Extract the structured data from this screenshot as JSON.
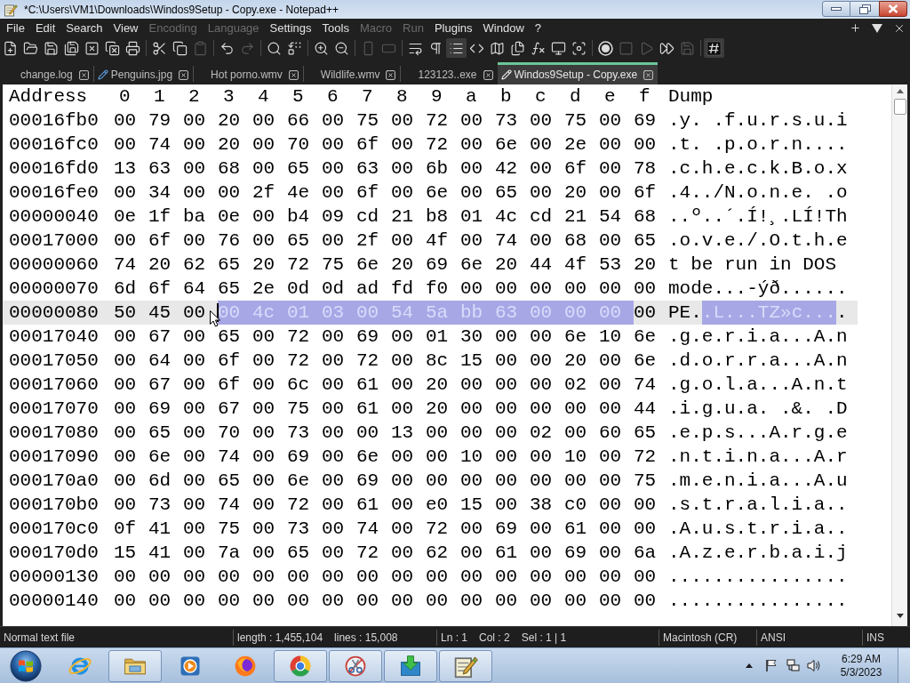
{
  "window": {
    "title": "*C:\\Users\\VM1\\Downloads\\Windos9Setup - Copy.exe - Notepad++"
  },
  "menu": [
    {
      "label": "File",
      "disabled": false
    },
    {
      "label": "Edit",
      "disabled": false
    },
    {
      "label": "Search",
      "disabled": false
    },
    {
      "label": "View",
      "disabled": false
    },
    {
      "label": "Encoding",
      "disabled": true
    },
    {
      "label": "Language",
      "disabled": true
    },
    {
      "label": "Settings",
      "disabled": false
    },
    {
      "label": "Tools",
      "disabled": false
    },
    {
      "label": "Macro",
      "disabled": true
    },
    {
      "label": "Run",
      "disabled": true
    },
    {
      "label": "Plugins",
      "disabled": false
    },
    {
      "label": "Window",
      "disabled": false
    },
    {
      "label": "?",
      "disabled": false
    }
  ],
  "toolbar": {
    "groups": [
      [
        {
          "disabled": false,
          "pressed": false
        },
        {
          "disabled": false,
          "pressed": false
        },
        {
          "disabled": false,
          "pressed": false
        },
        {
          "disabled": false,
          "pressed": false
        },
        {
          "disabled": false,
          "pressed": false
        },
        {
          "disabled": false,
          "pressed": false
        },
        {
          "disabled": false,
          "pressed": false
        }
      ],
      [
        {
          "disabled": false,
          "pressed": false
        },
        {
          "disabled": false,
          "pressed": false
        },
        {
          "disabled": true,
          "pressed": false
        }
      ],
      [
        {
          "disabled": false,
          "pressed": false
        },
        {
          "disabled": true,
          "pressed": false
        }
      ],
      [
        {
          "disabled": false,
          "pressed": false
        },
        {
          "disabled": false,
          "pressed": false
        }
      ],
      [
        {
          "disabled": false,
          "pressed": false
        },
        {
          "disabled": false,
          "pressed": false
        }
      ],
      [
        {
          "disabled": true,
          "pressed": false
        },
        {
          "disabled": true,
          "pressed": false
        }
      ],
      [
        {
          "disabled": false,
          "pressed": false
        },
        {
          "disabled": false,
          "pressed": false
        },
        {
          "disabled": false,
          "pressed": true
        },
        {
          "disabled": false,
          "pressed": false
        },
        {
          "disabled": false,
          "pressed": false
        },
        {
          "disabled": false,
          "pressed": false
        },
        {
          "disabled": false,
          "pressed": false
        },
        {
          "disabled": false,
          "pressed": false
        },
        {
          "disabled": false,
          "pressed": false
        }
      ],
      [
        {
          "disabled": false,
          "pressed": false
        },
        {
          "disabled": true,
          "pressed": false
        },
        {
          "disabled": true,
          "pressed": false
        },
        {
          "disabled": false,
          "pressed": false
        },
        {
          "disabled": true,
          "pressed": false
        }
      ],
      [
        {
          "disabled": false,
          "pressed": true
        }
      ]
    ]
  },
  "tabs": [
    {
      "label": "change.log",
      "modified": false,
      "selected": false
    },
    {
      "label": "Penguins.jpg",
      "modified": true,
      "selected": false
    },
    {
      "label": "Hot porno.wmv",
      "modified": false,
      "selected": false
    },
    {
      "label": "Wildlife.wmv",
      "modified": false,
      "selected": false
    },
    {
      "label": "123123..exe",
      "modified": false,
      "selected": false
    },
    {
      "label": "Windos9Setup - Copy.exe",
      "modified": true,
      "selected": true
    }
  ],
  "hex_view": {
    "columns": [
      "Address",
      "0",
      "1",
      "2",
      "3",
      "4",
      "5",
      "6",
      "7",
      "8",
      "9",
      "a",
      "b",
      "c",
      "d",
      "e",
      "f",
      "Dump"
    ],
    "rows": [
      {
        "address": "00016fb0",
        "current_line": false,
        "bytes": [
          {
            "hex": "00",
            "selected": false
          },
          {
            "hex": "79",
            "selected": false
          },
          {
            "hex": "00",
            "selected": false
          },
          {
            "hex": "20",
            "selected": false
          },
          {
            "hex": "00",
            "selected": false
          },
          {
            "hex": "66",
            "selected": false
          },
          {
            "hex": "00",
            "selected": false
          },
          {
            "hex": "75",
            "selected": false
          },
          {
            "hex": "00",
            "selected": false
          },
          {
            "hex": "72",
            "selected": false
          },
          {
            "hex": "00",
            "selected": false
          },
          {
            "hex": "73",
            "selected": false
          },
          {
            "hex": "00",
            "selected": false
          },
          {
            "hex": "75",
            "selected": false
          },
          {
            "hex": "00",
            "selected": false
          },
          {
            "hex": "69",
            "selected": false
          }
        ],
        "dump": [
          {
            "text": ".y. .f.u.r.s.u.i",
            "selected": false
          }
        ]
      },
      {
        "address": "00016fc0",
        "current_line": false,
        "bytes": [
          {
            "hex": "00",
            "selected": false
          },
          {
            "hex": "74",
            "selected": false
          },
          {
            "hex": "00",
            "selected": false
          },
          {
            "hex": "20",
            "selected": false
          },
          {
            "hex": "00",
            "selected": false
          },
          {
            "hex": "70",
            "selected": false
          },
          {
            "hex": "00",
            "selected": false
          },
          {
            "hex": "6f",
            "selected": false
          },
          {
            "hex": "00",
            "selected": false
          },
          {
            "hex": "72",
            "selected": false
          },
          {
            "hex": "00",
            "selected": false
          },
          {
            "hex": "6e",
            "selected": false
          },
          {
            "hex": "00",
            "selected": false
          },
          {
            "hex": "2e",
            "selected": false
          },
          {
            "hex": "00",
            "selected": false
          },
          {
            "hex": "00",
            "selected": false
          }
        ],
        "dump": [
          {
            "text": ".t. .p.o.r.n....",
            "selected": false
          }
        ]
      },
      {
        "address": "00016fd0",
        "current_line": false,
        "bytes": [
          {
            "hex": "13",
            "selected": false
          },
          {
            "hex": "63",
            "selected": false
          },
          {
            "hex": "00",
            "selected": false
          },
          {
            "hex": "68",
            "selected": false
          },
          {
            "hex": "00",
            "selected": false
          },
          {
            "hex": "65",
            "selected": false
          },
          {
            "hex": "00",
            "selected": false
          },
          {
            "hex": "63",
            "selected": false
          },
          {
            "hex": "00",
            "selected": false
          },
          {
            "hex": "6b",
            "selected": false
          },
          {
            "hex": "00",
            "selected": false
          },
          {
            "hex": "42",
            "selected": false
          },
          {
            "hex": "00",
            "selected": false
          },
          {
            "hex": "6f",
            "selected": false
          },
          {
            "hex": "00",
            "selected": false
          },
          {
            "hex": "78",
            "selected": false
          }
        ],
        "dump": [
          {
            "text": ".c.h.e.c.k.B.o.x",
            "selected": false
          }
        ]
      },
      {
        "address": "00016fe0",
        "current_line": false,
        "bytes": [
          {
            "hex": "00",
            "selected": false
          },
          {
            "hex": "34",
            "selected": false
          },
          {
            "hex": "00",
            "selected": false
          },
          {
            "hex": "00",
            "selected": false
          },
          {
            "hex": "2f",
            "selected": false
          },
          {
            "hex": "4e",
            "selected": false
          },
          {
            "hex": "00",
            "selected": false
          },
          {
            "hex": "6f",
            "selected": false
          },
          {
            "hex": "00",
            "selected": false
          },
          {
            "hex": "6e",
            "selected": false
          },
          {
            "hex": "00",
            "selected": false
          },
          {
            "hex": "65",
            "selected": false
          },
          {
            "hex": "00",
            "selected": false
          },
          {
            "hex": "20",
            "selected": false
          },
          {
            "hex": "00",
            "selected": false
          },
          {
            "hex": "6f",
            "selected": false
          }
        ],
        "dump": [
          {
            "text": ".4../N.o.n.e. .o",
            "selected": false
          }
        ]
      },
      {
        "address": "00000040",
        "current_line": false,
        "bytes": [
          {
            "hex": "0e",
            "selected": false
          },
          {
            "hex": "1f",
            "selected": false
          },
          {
            "hex": "ba",
            "selected": false
          },
          {
            "hex": "0e",
            "selected": false
          },
          {
            "hex": "00",
            "selected": false
          },
          {
            "hex": "b4",
            "selected": false
          },
          {
            "hex": "09",
            "selected": false
          },
          {
            "hex": "cd",
            "selected": false
          },
          {
            "hex": "21",
            "selected": false
          },
          {
            "hex": "b8",
            "selected": false
          },
          {
            "hex": "01",
            "selected": false
          },
          {
            "hex": "4c",
            "selected": false
          },
          {
            "hex": "cd",
            "selected": false
          },
          {
            "hex": "21",
            "selected": false
          },
          {
            "hex": "54",
            "selected": false
          },
          {
            "hex": "68",
            "selected": false
          }
        ],
        "dump": [
          {
            "text": "..º..´.Í!¸.LÍ!Th",
            "selected": false
          }
        ]
      },
      {
        "address": "00017000",
        "current_line": false,
        "bytes": [
          {
            "hex": "00",
            "selected": false
          },
          {
            "hex": "6f",
            "selected": false
          },
          {
            "hex": "00",
            "selected": false
          },
          {
            "hex": "76",
            "selected": false
          },
          {
            "hex": "00",
            "selected": false
          },
          {
            "hex": "65",
            "selected": false
          },
          {
            "hex": "00",
            "selected": false
          },
          {
            "hex": "2f",
            "selected": false
          },
          {
            "hex": "00",
            "selected": false
          },
          {
            "hex": "4f",
            "selected": false
          },
          {
            "hex": "00",
            "selected": false
          },
          {
            "hex": "74",
            "selected": false
          },
          {
            "hex": "00",
            "selected": false
          },
          {
            "hex": "68",
            "selected": false
          },
          {
            "hex": "00",
            "selected": false
          },
          {
            "hex": "65",
            "selected": false
          }
        ],
        "dump": [
          {
            "text": ".o.v.e./.O.t.h.e",
            "selected": false
          }
        ]
      },
      {
        "address": "00000060",
        "current_line": false,
        "bytes": [
          {
            "hex": "74",
            "selected": false
          },
          {
            "hex": "20",
            "selected": false
          },
          {
            "hex": "62",
            "selected": false
          },
          {
            "hex": "65",
            "selected": false
          },
          {
            "hex": "20",
            "selected": false
          },
          {
            "hex": "72",
            "selected": false
          },
          {
            "hex": "75",
            "selected": false
          },
          {
            "hex": "6e",
            "selected": false
          },
          {
            "hex": "20",
            "selected": false
          },
          {
            "hex": "69",
            "selected": false
          },
          {
            "hex": "6e",
            "selected": false
          },
          {
            "hex": "20",
            "selected": false
          },
          {
            "hex": "44",
            "selected": false
          },
          {
            "hex": "4f",
            "selected": false
          },
          {
            "hex": "53",
            "selected": false
          },
          {
            "hex": "20",
            "selected": false
          }
        ],
        "dump": [
          {
            "text": "t be run in DOS",
            "selected": false
          }
        ]
      },
      {
        "address": "00000070",
        "current_line": false,
        "bytes": [
          {
            "hex": "6d",
            "selected": false
          },
          {
            "hex": "6f",
            "selected": false
          },
          {
            "hex": "64",
            "selected": false
          },
          {
            "hex": "65",
            "selected": false
          },
          {
            "hex": "2e",
            "selected": false
          },
          {
            "hex": "0d",
            "selected": false
          },
          {
            "hex": "0d",
            "selected": false
          },
          {
            "hex": "ad",
            "selected": false
          },
          {
            "hex": "fd",
            "selected": false
          },
          {
            "hex": "f0",
            "selected": false
          },
          {
            "hex": "00",
            "selected": false
          },
          {
            "hex": "00",
            "selected": false
          },
          {
            "hex": "00",
            "selected": false
          },
          {
            "hex": "00",
            "selected": false
          },
          {
            "hex": "00",
            "selected": false
          },
          {
            "hex": "00",
            "selected": false
          }
        ],
        "dump": [
          {
            "text": "mode...-ýð......",
            "selected": false
          }
        ]
      },
      {
        "address": "00000080",
        "current_line": true,
        "bytes": [
          {
            "hex": "50",
            "selected": false
          },
          {
            "hex": "45",
            "selected": false
          },
          {
            "hex": "00",
            "selected": false
          },
          {
            "hex": "00",
            "selected": true
          },
          {
            "hex": "4c",
            "selected": true
          },
          {
            "hex": "01",
            "selected": true
          },
          {
            "hex": "03",
            "selected": true
          },
          {
            "hex": "00",
            "selected": true
          },
          {
            "hex": "54",
            "selected": true
          },
          {
            "hex": "5a",
            "selected": true
          },
          {
            "hex": "bb",
            "selected": true
          },
          {
            "hex": "63",
            "selected": true
          },
          {
            "hex": "00",
            "selected": true
          },
          {
            "hex": "00",
            "selected": true
          },
          {
            "hex": "00",
            "selected": true
          },
          {
            "hex": "00",
            "selected": false
          }
        ],
        "dump": [
          {
            "text": "PE.",
            "selected": false
          },
          {
            "text": ".L...TZ»c...",
            "selected": true
          },
          {
            "text": ".",
            "selected": false
          }
        ]
      },
      {
        "address": "00017040",
        "current_line": false,
        "bytes": [
          {
            "hex": "00",
            "selected": false
          },
          {
            "hex": "67",
            "selected": false
          },
          {
            "hex": "00",
            "selected": false
          },
          {
            "hex": "65",
            "selected": false
          },
          {
            "hex": "00",
            "selected": false
          },
          {
            "hex": "72",
            "selected": false
          },
          {
            "hex": "00",
            "selected": false
          },
          {
            "hex": "69",
            "selected": false
          },
          {
            "hex": "00",
            "selected": false
          },
          {
            "hex": "01",
            "selected": false
          },
          {
            "hex": "30",
            "selected": false
          },
          {
            "hex": "00",
            "selected": false
          },
          {
            "hex": "00",
            "selected": false
          },
          {
            "hex": "6e",
            "selected": false
          },
          {
            "hex": "10",
            "selected": false
          },
          {
            "hex": "6e",
            "selected": false
          }
        ],
        "dump": [
          {
            "text": ".g.e.r.i.a...A.n",
            "selected": false
          }
        ]
      },
      {
        "address": "00017050",
        "current_line": false,
        "bytes": [
          {
            "hex": "00",
            "selected": false
          },
          {
            "hex": "64",
            "selected": false
          },
          {
            "hex": "00",
            "selected": false
          },
          {
            "hex": "6f",
            "selected": false
          },
          {
            "hex": "00",
            "selected": false
          },
          {
            "hex": "72",
            "selected": false
          },
          {
            "hex": "00",
            "selected": false
          },
          {
            "hex": "72",
            "selected": false
          },
          {
            "hex": "00",
            "selected": false
          },
          {
            "hex": "8c",
            "selected": false
          },
          {
            "hex": "15",
            "selected": false
          },
          {
            "hex": "00",
            "selected": false
          },
          {
            "hex": "00",
            "selected": false
          },
          {
            "hex": "20",
            "selected": false
          },
          {
            "hex": "00",
            "selected": false
          },
          {
            "hex": "6e",
            "selected": false
          }
        ],
        "dump": [
          {
            "text": ".d.o.r.r.a...A.n",
            "selected": false
          }
        ]
      },
      {
        "address": "00017060",
        "current_line": false,
        "bytes": [
          {
            "hex": "00",
            "selected": false
          },
          {
            "hex": "67",
            "selected": false
          },
          {
            "hex": "00",
            "selected": false
          },
          {
            "hex": "6f",
            "selected": false
          },
          {
            "hex": "00",
            "selected": false
          },
          {
            "hex": "6c",
            "selected": false
          },
          {
            "hex": "00",
            "selected": false
          },
          {
            "hex": "61",
            "selected": false
          },
          {
            "hex": "00",
            "selected": false
          },
          {
            "hex": "20",
            "selected": false
          },
          {
            "hex": "00",
            "selected": false
          },
          {
            "hex": "00",
            "selected": false
          },
          {
            "hex": "00",
            "selected": false
          },
          {
            "hex": "02",
            "selected": false
          },
          {
            "hex": "00",
            "selected": false
          },
          {
            "hex": "74",
            "selected": false
          }
        ],
        "dump": [
          {
            "text": ".g.o.l.a...A.n.t",
            "selected": false
          }
        ]
      },
      {
        "address": "00017070",
        "current_line": false,
        "bytes": [
          {
            "hex": "00",
            "selected": false
          },
          {
            "hex": "69",
            "selected": false
          },
          {
            "hex": "00",
            "selected": false
          },
          {
            "hex": "67",
            "selected": false
          },
          {
            "hex": "00",
            "selected": false
          },
          {
            "hex": "75",
            "selected": false
          },
          {
            "hex": "00",
            "selected": false
          },
          {
            "hex": "61",
            "selected": false
          },
          {
            "hex": "00",
            "selected": false
          },
          {
            "hex": "20",
            "selected": false
          },
          {
            "hex": "00",
            "selected": false
          },
          {
            "hex": "00",
            "selected": false
          },
          {
            "hex": "00",
            "selected": false
          },
          {
            "hex": "00",
            "selected": false
          },
          {
            "hex": "00",
            "selected": false
          },
          {
            "hex": "44",
            "selected": false
          }
        ],
        "dump": [
          {
            "text": ".i.g.u.a. .&. .D",
            "selected": false
          }
        ]
      },
      {
        "address": "00017080",
        "current_line": false,
        "bytes": [
          {
            "hex": "00",
            "selected": false
          },
          {
            "hex": "65",
            "selected": false
          },
          {
            "hex": "00",
            "selected": false
          },
          {
            "hex": "70",
            "selected": false
          },
          {
            "hex": "00",
            "selected": false
          },
          {
            "hex": "73",
            "selected": false
          },
          {
            "hex": "00",
            "selected": false
          },
          {
            "hex": "00",
            "selected": false
          },
          {
            "hex": "13",
            "selected": false
          },
          {
            "hex": "00",
            "selected": false
          },
          {
            "hex": "00",
            "selected": false
          },
          {
            "hex": "00",
            "selected": false
          },
          {
            "hex": "02",
            "selected": false
          },
          {
            "hex": "00",
            "selected": false
          },
          {
            "hex": "60",
            "selected": false
          },
          {
            "hex": "65",
            "selected": false
          }
        ],
        "dump": [
          {
            "text": ".e.p.s...A.r.g.e",
            "selected": false
          }
        ]
      },
      {
        "address": "00017090",
        "current_line": false,
        "bytes": [
          {
            "hex": "00",
            "selected": false
          },
          {
            "hex": "6e",
            "selected": false
          },
          {
            "hex": "00",
            "selected": false
          },
          {
            "hex": "74",
            "selected": false
          },
          {
            "hex": "00",
            "selected": false
          },
          {
            "hex": "69",
            "selected": false
          },
          {
            "hex": "00",
            "selected": false
          },
          {
            "hex": "6e",
            "selected": false
          },
          {
            "hex": "00",
            "selected": false
          },
          {
            "hex": "00",
            "selected": false
          },
          {
            "hex": "10",
            "selected": false
          },
          {
            "hex": "00",
            "selected": false
          },
          {
            "hex": "00",
            "selected": false
          },
          {
            "hex": "10",
            "selected": false
          },
          {
            "hex": "00",
            "selected": false
          },
          {
            "hex": "72",
            "selected": false
          }
        ],
        "dump": [
          {
            "text": ".n.t.i.n.a...A.r",
            "selected": false
          }
        ]
      },
      {
        "address": "000170a0",
        "current_line": false,
        "bytes": [
          {
            "hex": "00",
            "selected": false
          },
          {
            "hex": "6d",
            "selected": false
          },
          {
            "hex": "00",
            "selected": false
          },
          {
            "hex": "65",
            "selected": false
          },
          {
            "hex": "00",
            "selected": false
          },
          {
            "hex": "6e",
            "selected": false
          },
          {
            "hex": "00",
            "selected": false
          },
          {
            "hex": "69",
            "selected": false
          },
          {
            "hex": "00",
            "selected": false
          },
          {
            "hex": "00",
            "selected": false
          },
          {
            "hex": "00",
            "selected": false
          },
          {
            "hex": "00",
            "selected": false
          },
          {
            "hex": "00",
            "selected": false
          },
          {
            "hex": "00",
            "selected": false
          },
          {
            "hex": "00",
            "selected": false
          },
          {
            "hex": "75",
            "selected": false
          }
        ],
        "dump": [
          {
            "text": ".m.e.n.i.a...A.u",
            "selected": false
          }
        ]
      },
      {
        "address": "000170b0",
        "current_line": false,
        "bytes": [
          {
            "hex": "00",
            "selected": false
          },
          {
            "hex": "73",
            "selected": false
          },
          {
            "hex": "00",
            "selected": false
          },
          {
            "hex": "74",
            "selected": false
          },
          {
            "hex": "00",
            "selected": false
          },
          {
            "hex": "72",
            "selected": false
          },
          {
            "hex": "00",
            "selected": false
          },
          {
            "hex": "61",
            "selected": false
          },
          {
            "hex": "00",
            "selected": false
          },
          {
            "hex": "e0",
            "selected": false
          },
          {
            "hex": "15",
            "selected": false
          },
          {
            "hex": "00",
            "selected": false
          },
          {
            "hex": "38",
            "selected": false
          },
          {
            "hex": "c0",
            "selected": false
          },
          {
            "hex": "00",
            "selected": false
          },
          {
            "hex": "00",
            "selected": false
          }
        ],
        "dump": [
          {
            "text": ".s.t.r.a.l.i.a..",
            "selected": false
          }
        ]
      },
      {
        "address": "000170c0",
        "current_line": false,
        "bytes": [
          {
            "hex": "0f",
            "selected": false
          },
          {
            "hex": "41",
            "selected": false
          },
          {
            "hex": "00",
            "selected": false
          },
          {
            "hex": "75",
            "selected": false
          },
          {
            "hex": "00",
            "selected": false
          },
          {
            "hex": "73",
            "selected": false
          },
          {
            "hex": "00",
            "selected": false
          },
          {
            "hex": "74",
            "selected": false
          },
          {
            "hex": "00",
            "selected": false
          },
          {
            "hex": "72",
            "selected": false
          },
          {
            "hex": "00",
            "selected": false
          },
          {
            "hex": "69",
            "selected": false
          },
          {
            "hex": "00",
            "selected": false
          },
          {
            "hex": "61",
            "selected": false
          },
          {
            "hex": "00",
            "selected": false
          },
          {
            "hex": "00",
            "selected": false
          }
        ],
        "dump": [
          {
            "text": ".A.u.s.t.r.i.a..",
            "selected": false
          }
        ]
      },
      {
        "address": "000170d0",
        "current_line": false,
        "bytes": [
          {
            "hex": "15",
            "selected": false
          },
          {
            "hex": "41",
            "selected": false
          },
          {
            "hex": "00",
            "selected": false
          },
          {
            "hex": "7a",
            "selected": false
          },
          {
            "hex": "00",
            "selected": false
          },
          {
            "hex": "65",
            "selected": false
          },
          {
            "hex": "00",
            "selected": false
          },
          {
            "hex": "72",
            "selected": false
          },
          {
            "hex": "00",
            "selected": false
          },
          {
            "hex": "62",
            "selected": false
          },
          {
            "hex": "00",
            "selected": false
          },
          {
            "hex": "61",
            "selected": false
          },
          {
            "hex": "00",
            "selected": false
          },
          {
            "hex": "69",
            "selected": false
          },
          {
            "hex": "00",
            "selected": false
          },
          {
            "hex": "6a",
            "selected": false
          }
        ],
        "dump": [
          {
            "text": ".A.z.e.r.b.a.i.j",
            "selected": false
          }
        ]
      },
      {
        "address": "00000130",
        "current_line": false,
        "bytes": [
          {
            "hex": "00",
            "selected": false
          },
          {
            "hex": "00",
            "selected": false
          },
          {
            "hex": "00",
            "selected": false
          },
          {
            "hex": "00",
            "selected": false
          },
          {
            "hex": "00",
            "selected": false
          },
          {
            "hex": "00",
            "selected": false
          },
          {
            "hex": "00",
            "selected": false
          },
          {
            "hex": "00",
            "selected": false
          },
          {
            "hex": "00",
            "selected": false
          },
          {
            "hex": "00",
            "selected": false
          },
          {
            "hex": "00",
            "selected": false
          },
          {
            "hex": "00",
            "selected": false
          },
          {
            "hex": "00",
            "selected": false
          },
          {
            "hex": "00",
            "selected": false
          },
          {
            "hex": "00",
            "selected": false
          },
          {
            "hex": "00",
            "selected": false
          }
        ],
        "dump": [
          {
            "text": "................",
            "selected": false
          }
        ]
      },
      {
        "address": "00000140",
        "current_line": false,
        "bytes": [
          {
            "hex": "00",
            "selected": false
          },
          {
            "hex": "00",
            "selected": false
          },
          {
            "hex": "00",
            "selected": false
          },
          {
            "hex": "00",
            "selected": false
          },
          {
            "hex": "00",
            "selected": false
          },
          {
            "hex": "00",
            "selected": false
          },
          {
            "hex": "00",
            "selected": false
          },
          {
            "hex": "00",
            "selected": false
          },
          {
            "hex": "00",
            "selected": false
          },
          {
            "hex": "00",
            "selected": false
          },
          {
            "hex": "00",
            "selected": false
          },
          {
            "hex": "00",
            "selected": false
          },
          {
            "hex": "00",
            "selected": false
          },
          {
            "hex": "00",
            "selected": false
          },
          {
            "hex": "00",
            "selected": false
          },
          {
            "hex": "00",
            "selected": false
          }
        ],
        "dump": [
          {
            "text": "................",
            "selected": false
          }
        ]
      }
    ]
  },
  "status_bar": {
    "sections": [
      [
        "Normal text file"
      ],
      [
        "length : 1,455,104",
        "lines : 15,008"
      ],
      [
        "Ln : 1",
        "Col : 2",
        "Sel : 1 | 1"
      ],
      [
        "Macintosh (CR)"
      ],
      [
        "ANSI"
      ],
      [
        "INS"
      ]
    ]
  },
  "taskbar": {
    "apps": [
      {
        "running": false
      },
      {
        "running": true
      },
      {
        "running": false
      },
      {
        "running": false
      },
      {
        "running": true
      },
      {
        "running": true
      },
      {
        "running": true
      },
      {
        "running": true
      }
    ],
    "clock": {
      "time": "6:29 AM",
      "date": "5/3/2023"
    }
  }
}
